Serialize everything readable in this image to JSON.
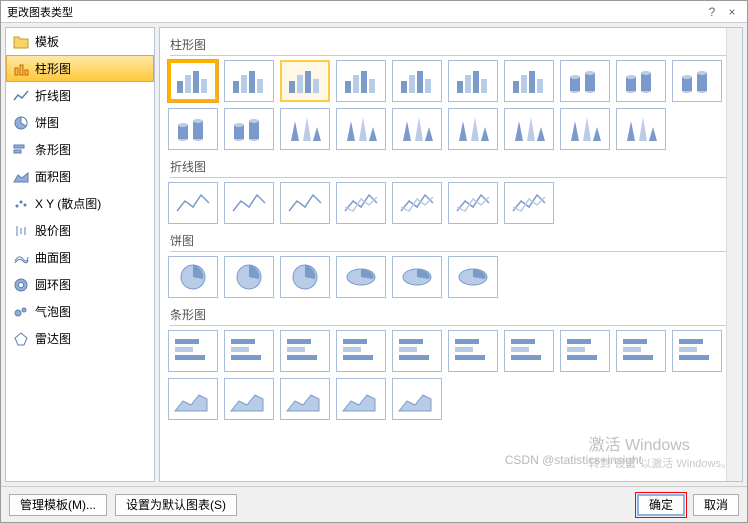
{
  "dialog": {
    "title": "更改图表类型",
    "help_icon": "?",
    "close_icon": "×"
  },
  "sidebar": {
    "header": {
      "label": "模板",
      "icon": "folder"
    },
    "items": [
      {
        "label": "柱形图",
        "icon": "column",
        "selected": true
      },
      {
        "label": "折线图",
        "icon": "line"
      },
      {
        "label": "饼图",
        "icon": "pie"
      },
      {
        "label": "条形图",
        "icon": "bar"
      },
      {
        "label": "面积图",
        "icon": "area"
      },
      {
        "label": "X Y (散点图)",
        "icon": "scatter"
      },
      {
        "label": "股价图",
        "icon": "stock"
      },
      {
        "label": "曲面图",
        "icon": "surface"
      },
      {
        "label": "圆环图",
        "icon": "doughnut"
      },
      {
        "label": "气泡图",
        "icon": "bubble"
      },
      {
        "label": "雷达图",
        "icon": "radar"
      }
    ]
  },
  "sections": [
    {
      "label": "柱形图",
      "count": 19,
      "selectedIndex": 0,
      "hoveredIndex": 2
    },
    {
      "label": "折线图",
      "count": 7
    },
    {
      "label": "饼图",
      "count": 6
    },
    {
      "label": "条形图",
      "count": 15
    }
  ],
  "footer": {
    "manage": "管理模板(M)...",
    "set_default": "设置为默认图表(S)",
    "ok": "确定",
    "cancel": "取消"
  },
  "watermark": {
    "title": "激活 Windows",
    "subtitle": "转到\"设置\"以激活 Windows。"
  },
  "csdn_watermark": "CSDN @statistics+insight"
}
